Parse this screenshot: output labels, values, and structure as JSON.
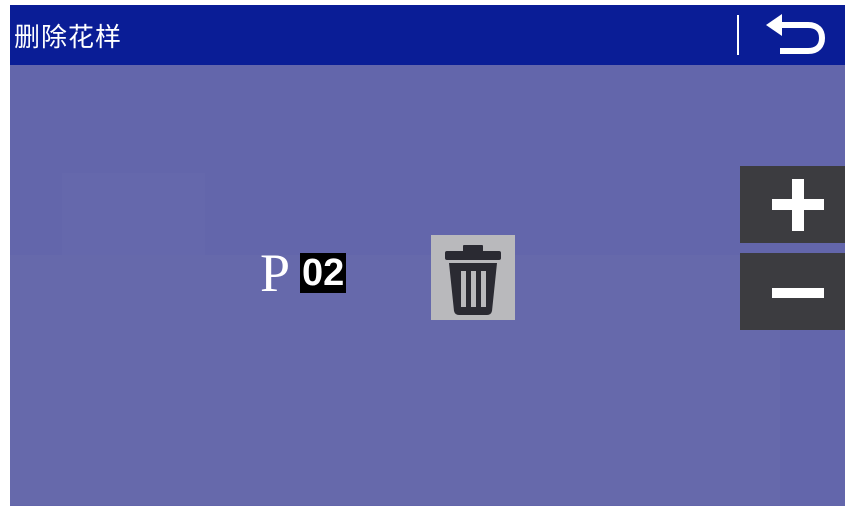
{
  "header": {
    "title": "删除花样",
    "back_icon": "undo-arrow-icon",
    "bar_color": "#0a1d96"
  },
  "main": {
    "background_color": "#6366ab",
    "pattern_prefix": "P",
    "pattern_number": "02",
    "delete_icon": "trash-icon"
  },
  "side_buttons": {
    "increment_icon": "plus-icon",
    "decrement_icon": "minus-icon",
    "color": "#3c3c40"
  }
}
